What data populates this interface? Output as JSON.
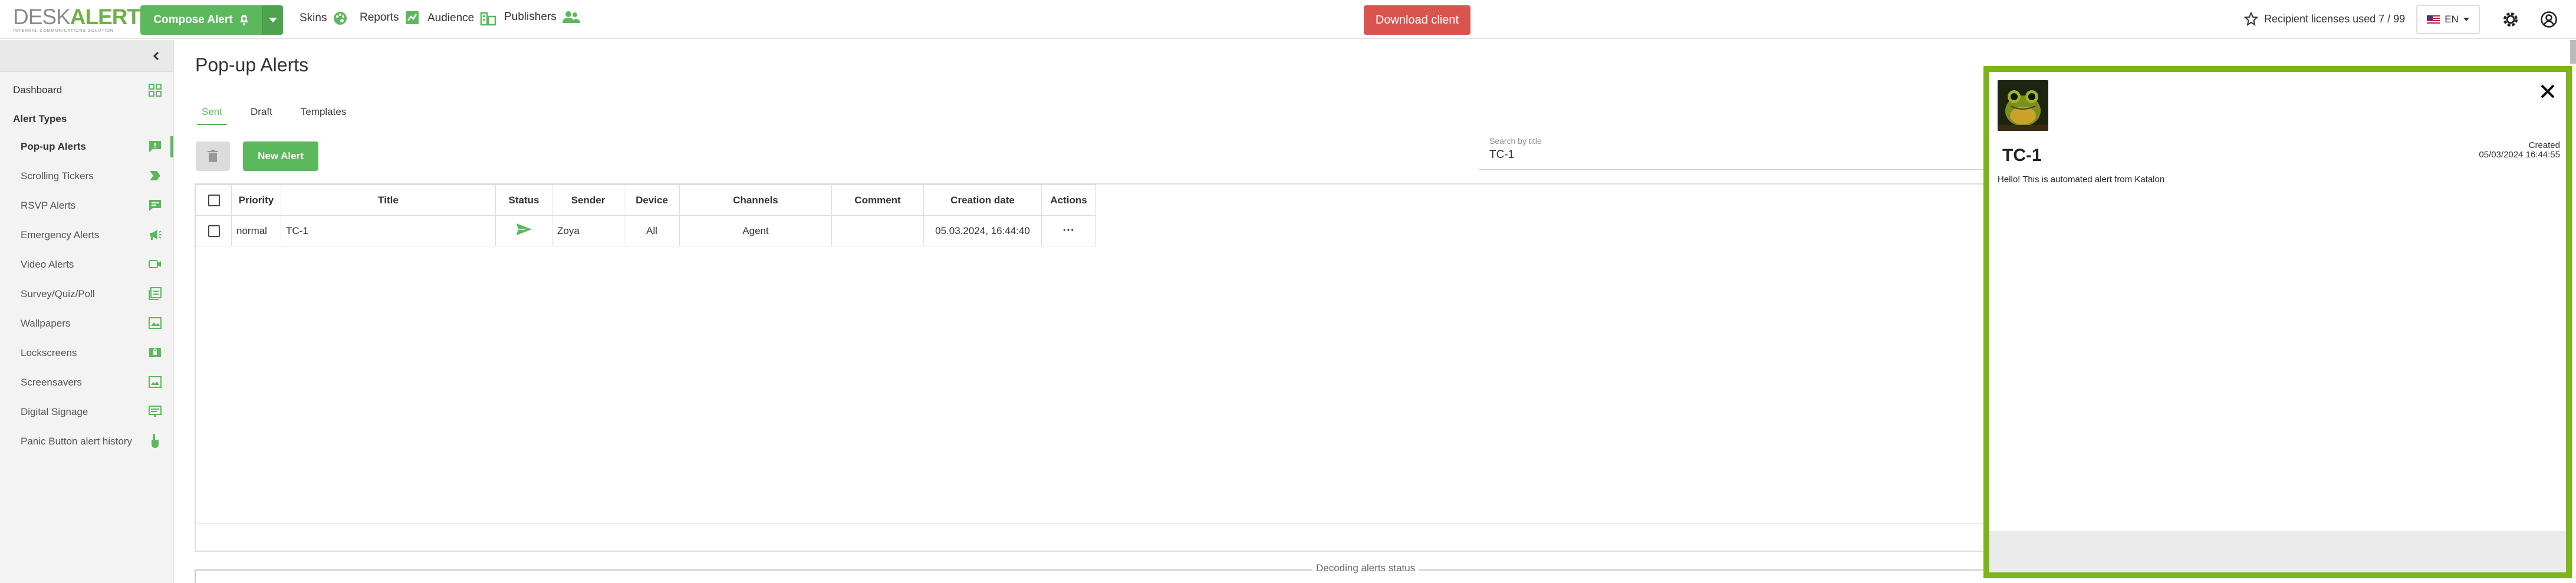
{
  "header": {
    "logo_word_desk": "DESK",
    "logo_word_alerts": "ALERTS",
    "logo_tagline": "INTERNAL COMMUNICATIONS SOLUTION",
    "compose_label": "Compose Alert",
    "nav": [
      {
        "label": "Skins",
        "icon": "palette-icon"
      },
      {
        "label": "Reports",
        "icon": "reports-icon"
      },
      {
        "label": "Audience",
        "icon": "audience-icon"
      },
      {
        "label": "Publishers",
        "icon": "publishers-icon"
      }
    ],
    "download_label": "Download client",
    "licenses_label": "Recipient licenses used 7 / 99",
    "language": "EN"
  },
  "sidebar": {
    "dashboard": "Dashboard",
    "section_title": "Alert Types",
    "items": [
      {
        "label": "Pop-up Alerts",
        "active": true,
        "icon": "popup-alert-icon"
      },
      {
        "label": "Scrolling Tickers",
        "icon": "ticker-icon"
      },
      {
        "label": "RSVP Alerts",
        "icon": "rsvp-icon"
      },
      {
        "label": "Emergency Alerts",
        "icon": "megaphone-icon"
      },
      {
        "label": "Video Alerts",
        "icon": "video-icon"
      },
      {
        "label": "Survey/Quiz/Poll",
        "icon": "survey-icon"
      },
      {
        "label": "Wallpapers",
        "icon": "wallpaper-icon"
      },
      {
        "label": "Lockscreens",
        "icon": "lockscreen-icon"
      },
      {
        "label": "Screensavers",
        "icon": "screensaver-icon"
      },
      {
        "label": "Digital Signage",
        "icon": "signage-icon"
      },
      {
        "label": "Panic Button alert history",
        "icon": "panic-hand-icon"
      }
    ]
  },
  "main": {
    "title": "Pop-up Alerts",
    "tabs": [
      "Sent",
      "Draft",
      "Templates"
    ],
    "active_tab": "Sent",
    "new_alert_label": "New Alert",
    "search": {
      "label": "Search by title",
      "value": "TC-1"
    },
    "table": {
      "columns": [
        "Priority",
        "Title",
        "Status",
        "Sender",
        "Device",
        "Channels",
        "Comment",
        "Creation date",
        "Actions"
      ],
      "rows": [
        {
          "priority": "normal",
          "title": "TC-1",
          "status": "sent",
          "sender": "Zoya",
          "device": "All",
          "channels": "Agent",
          "comment": "",
          "creation_date": "05.03.2024, 16:44:40",
          "actions": "···"
        }
      ]
    },
    "decoding_label": "Decoding alerts status"
  },
  "popup": {
    "title": "TC-1",
    "created_label": "Created",
    "created_value": "05/03/2024 16:44:55",
    "body": "Hello! This is automated alert from Katalon"
  },
  "colors": {
    "brand_green": "#5cb85c",
    "popup_border": "#7cb518",
    "download_red": "#d9534f"
  }
}
